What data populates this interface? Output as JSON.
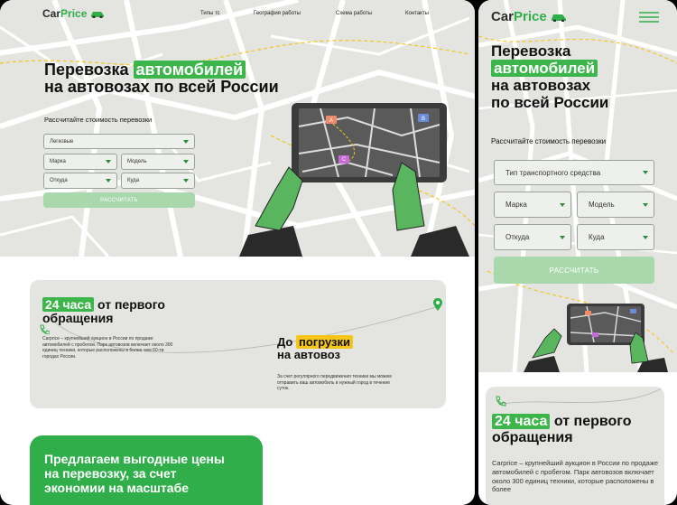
{
  "brand": {
    "name_part1": "Car",
    "name_part2": "Price",
    "accent": "#2fae4a",
    "accent_light": "#a9d8ad",
    "highlight_yellow": "#f5c518"
  },
  "nav": [
    "Типы тс",
    "География работы",
    "Схема работы",
    "Контакты"
  ],
  "hero": {
    "line1_pre": "Перевозка ",
    "line1_hl": "автомобилей",
    "line2": "на автовозах по всей России",
    "mob_l1": "Перевозка",
    "mob_l2": "автомобилей",
    "mob_l3": "на автовозах",
    "mob_l4": "по всей России"
  },
  "form": {
    "title": "Рассчитайте стоимость перевозки",
    "type_desk": "Легковые",
    "type_mob": "Тип транспортного средства",
    "brand": "Марка",
    "model": "Модель",
    "from": "Откуда",
    "to": "Куда",
    "submit": "РАССЧИТАТЬ"
  },
  "tablet_pins": [
    "A",
    "B",
    "C"
  ],
  "info": {
    "hours_hl": "24 часа",
    "hours_rest": " от первого",
    "hours_line2": "обращения",
    "desc": "Carprice – крупнейший аукцион в России по продаже автомобилей с пробегом. Парк автовозов включает около 300 единиц техники, которые расположены в более чем 60-ти городах России.",
    "mob_desc": "Carprice – крупнейший аукцион в России по продаже автомобилей с пробегом. Парк автовозов включает около 300 единиц техники, которые расположены в более",
    "load_pre": "До ",
    "load_hl": "погрузки",
    "load_line2": "на автовоз",
    "load_desc": "За счет регулярного передвижения техники мы можем отправить ваш автомобиль в нужный город в течение суток."
  },
  "offer": {
    "line1": "Предлагаем выгодные цены",
    "line2": "на перевозку, за счет",
    "line3": "экономии на масштабе"
  }
}
